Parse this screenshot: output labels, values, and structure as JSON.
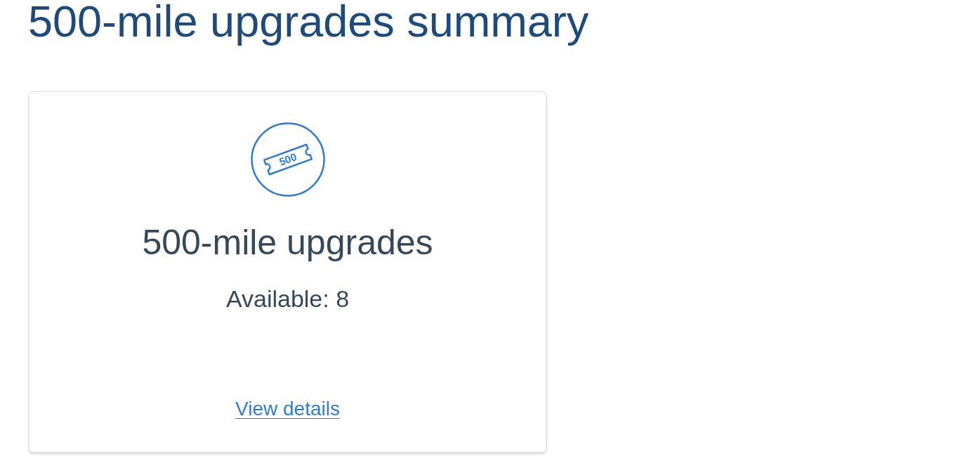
{
  "page": {
    "title": "500-mile upgrades summary"
  },
  "cards": [
    {
      "icon_label": "500",
      "title": "500-mile upgrades",
      "available": "Available: 8",
      "link": "View details"
    }
  ]
}
